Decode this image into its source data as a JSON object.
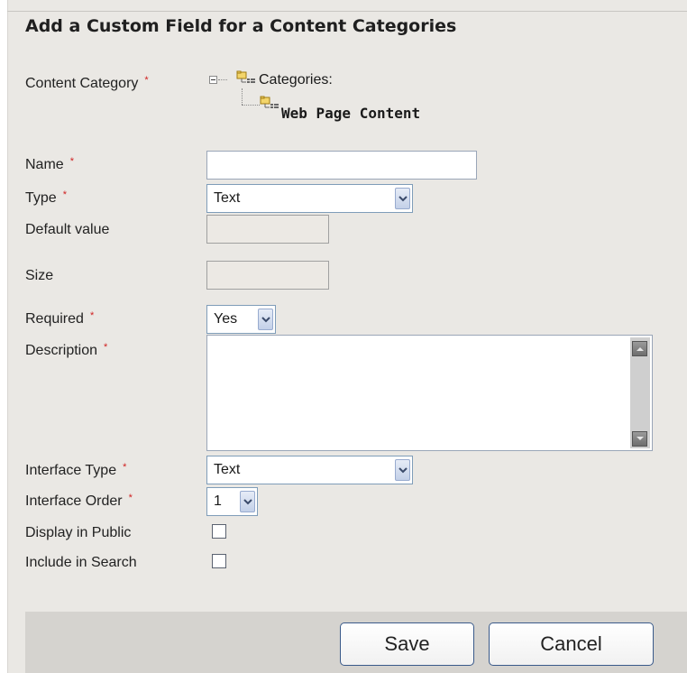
{
  "form": {
    "title": "Add a Custom Field for a Content Categories",
    "required_marker": "*",
    "content_category": {
      "label": "Content Category",
      "tree": {
        "root": "Categories:",
        "child": "Web Page Content"
      }
    },
    "name": {
      "label": "Name",
      "value": ""
    },
    "type": {
      "label": "Type",
      "selected": "Text"
    },
    "default_value": {
      "label": "Default value",
      "value": ""
    },
    "size": {
      "label": "Size",
      "value": ""
    },
    "required": {
      "label": "Required",
      "selected": "Yes"
    },
    "description": {
      "label": "Description",
      "value": ""
    },
    "interface_type": {
      "label": "Interface Type",
      "selected": "Text"
    },
    "interface_order": {
      "label": "Interface Order",
      "selected": "1"
    },
    "display_in_public": {
      "label": "Display in Public",
      "checked": false
    },
    "include_in_search": {
      "label": "Include in Search",
      "checked": false
    }
  },
  "footer": {
    "save_label": "Save",
    "cancel_label": "Cancel"
  },
  "icons": {
    "tree_toggle": "collapse-minus-icon",
    "folder": "folder-tree-icon",
    "dropdown": "chevron-down-icon",
    "scroll_up": "scroll-up-arrow-icon",
    "scroll_down": "scroll-down-arrow-icon"
  },
  "colors": {
    "panel_bg": "#eae8e4",
    "footer_bg": "#d5d3cf",
    "required_marker": "#d02020",
    "input_border": "#7f9db9"
  }
}
